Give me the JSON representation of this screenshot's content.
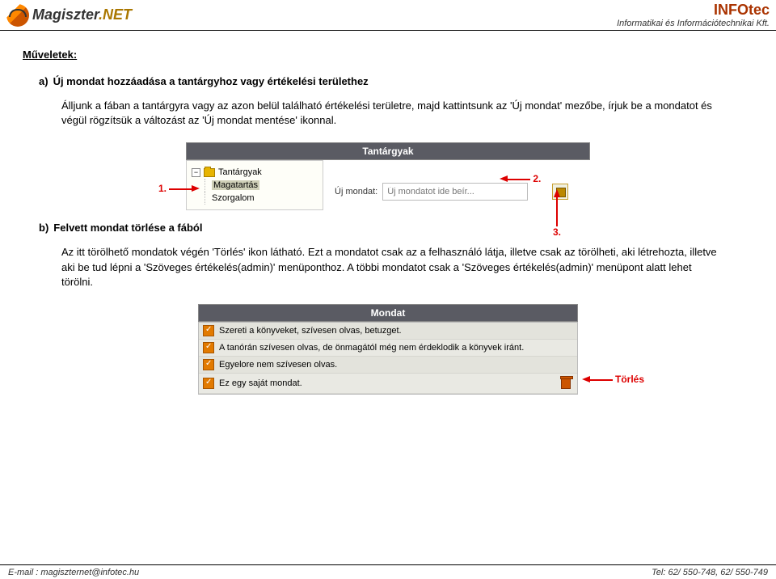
{
  "header": {
    "logo_main": "Magiszter",
    "logo_ext": ".NET",
    "company": "INFOtec",
    "company_sub": "Informatikai és Információtechnikai Kft."
  },
  "title": "Műveletek:",
  "section_a": {
    "label": "a)",
    "heading": "Új mondat hozzáadása a tantárgyhoz vagy értékelési területhez",
    "paragraph": "Álljunk a fában a tantárgyra vagy az azon belül található értékelési területre, majd kattintsunk az 'Új mondat' mezőbe, írjuk be a mondatot és végül rögzítsük a változást az 'Új mondat mentése' ikonnal."
  },
  "figure1": {
    "panel_title": "Tantárgyak",
    "tree": {
      "root": "Tantárgyak",
      "item1": "Magatartás",
      "item2": "Szorgalom"
    },
    "field_label": "Új mondat:",
    "placeholder": "Új mondatot ide beír...",
    "ann1": "1.",
    "ann2": "2.",
    "ann3": "3."
  },
  "section_b": {
    "label": "b)",
    "heading": "Felvett mondat törlése a fából",
    "paragraph": "Az itt törölhető mondatok végén 'Törlés' ikon látható. Ezt a mondatot csak az a felhasználó látja, illetve csak az törölheti, aki létrehozta, illetve aki be tud lépni a 'Szöveges értékelés(admin)' menüponthoz. A többi mondatot csak a 'Szöveges értékelés(admin)' menüpont alatt lehet törölni."
  },
  "figure2": {
    "panel_title": "Mondat",
    "rows": [
      "Szereti a könyveket, szívesen olvas, betuzget.",
      "A tanórán szívesen olvas, de önmagától még nem érdeklodik a könyvek iránt.",
      "Egyelore nem szívesen olvas.",
      "Ez egy saját mondat."
    ],
    "delete_label": "Törlés"
  },
  "footer": {
    "email": "E-mail : magiszternet@infotec.hu",
    "tel": "Tel: 62/ 550-748, 62/ 550-749"
  }
}
